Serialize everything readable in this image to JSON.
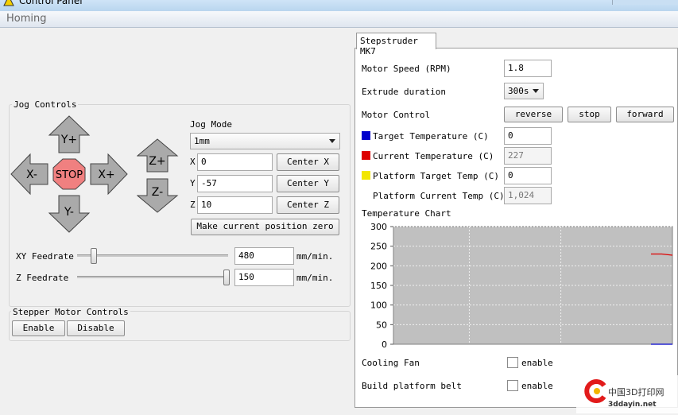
{
  "window": {
    "title": "Control Panel"
  },
  "menu": {
    "label": "Homing"
  },
  "jog": {
    "group_title": "Jog Controls",
    "buttons": {
      "y_plus": "Y+",
      "y_minus": "Y-",
      "x_minus": "X-",
      "x_plus": "X+",
      "stop": "STOP",
      "z_plus": "Z+",
      "z_minus": "Z-"
    },
    "mode_label": "Jog Mode",
    "mode_value": "1mm",
    "x_label": "X",
    "x_value": "0",
    "center_x": "Center X",
    "y_label": "Y",
    "y_value": "-57",
    "center_y": "Center Y",
    "z_label": "Z",
    "z_value": "10",
    "center_z": "Center Z",
    "make_zero": "Make current position zero",
    "xy_feedrate_label": "XY Feedrate",
    "xy_feedrate_value": "480",
    "z_feedrate_label": "Z Feedrate",
    "z_feedrate_value": "150",
    "feed_unit": "mm/min.",
    "xy_slider_level": 0.09,
    "z_slider_level": 1.0
  },
  "stepper": {
    "group_title": "Stepper Motor Controls",
    "enable": "Enable",
    "disable": "Disable"
  },
  "extruder": {
    "tab_label": "Stepstruder MK7",
    "motor_speed_label": "Motor Speed (RPM)",
    "motor_speed_value": "1.8",
    "extrude_duration_label": "Extrude duration",
    "extrude_duration_value": "300s",
    "motor_control_label": "Motor Control",
    "reverse": "reverse",
    "stop": "stop",
    "forward": "forward",
    "target_temp_label": "Target Temperature (C)",
    "target_temp_value": "0",
    "current_temp_label": "Current Temperature (C)",
    "current_temp_value": "227",
    "platform_target_label": "Platform Target Temp (C)",
    "platform_target_value": "0",
    "platform_current_label": "Platform Current Temp (C)",
    "platform_current_value": "1,024",
    "colors": {
      "target": "#0000cc",
      "current": "#dd0000",
      "platform_target": "#f2e600",
      "platform_current": "#ffffff"
    },
    "chart_title": "Temperature Chart",
    "cooling_fan_label": "Cooling Fan",
    "cooling_fan_option": "enable",
    "build_belt_label": "Build platform belt",
    "build_belt_option": "enable"
  },
  "watermark": {
    "text": "中国3D打印网",
    "url": "3ddayin.net"
  },
  "chart_data": {
    "type": "line",
    "title": "Temperature Chart",
    "ylim": [
      0,
      300
    ],
    "yticks": [
      0,
      50,
      100,
      150,
      200,
      250,
      300
    ],
    "grid": true,
    "x": [
      0.0,
      0.5,
      1.0
    ],
    "series": [
      {
        "values": [
          230,
          230,
          227
        ],
        "color": "#dd0000"
      },
      {
        "values": [
          0,
          0,
          0
        ],
        "color": "#0000cc"
      }
    ]
  }
}
